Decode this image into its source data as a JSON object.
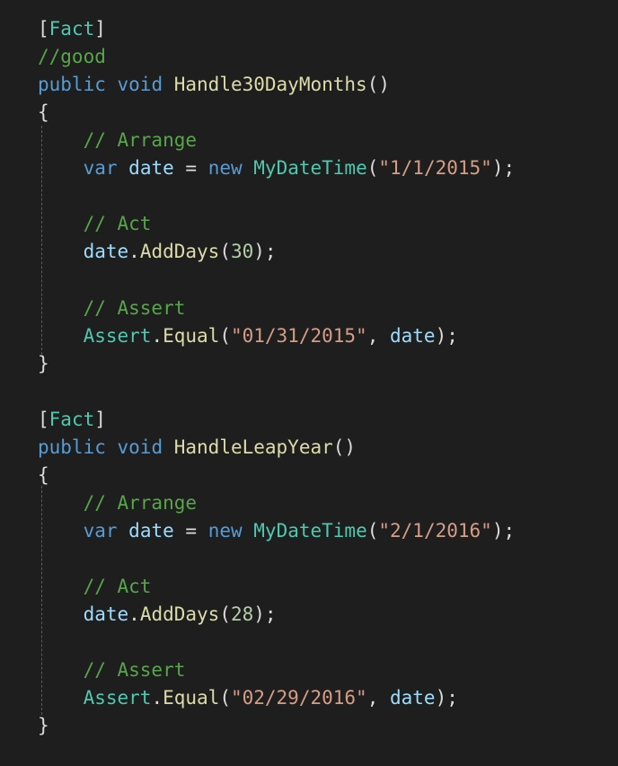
{
  "editor": {
    "language": "C#",
    "theme": "dark",
    "background": "#1e1e1e",
    "colors": {
      "plain": "#dcdcdc",
      "keyword": "#569cd6",
      "type": "#4ec9b0",
      "method": "#dcdcaa",
      "comment": "#57a64a",
      "string": "#d69d85",
      "number": "#b5cea8",
      "variable": "#9cdcfe"
    },
    "lines": [
      [
        [
          "plain",
          "["
        ],
        [
          "type",
          "Fact"
        ],
        [
          "plain",
          "]"
        ]
      ],
      [
        [
          "comment",
          "//good"
        ]
      ],
      [
        [
          "keyword",
          "public"
        ],
        [
          "plain",
          " "
        ],
        [
          "keyword",
          "void"
        ],
        [
          "plain",
          " "
        ],
        [
          "method",
          "Handle30DayMonths"
        ],
        [
          "plain",
          "()"
        ]
      ],
      [
        [
          "plain",
          "{"
        ]
      ],
      [
        [
          "plain",
          "    "
        ],
        [
          "comment",
          "// Arrange"
        ]
      ],
      [
        [
          "plain",
          "    "
        ],
        [
          "keyword",
          "var"
        ],
        [
          "plain",
          " "
        ],
        [
          "var",
          "date"
        ],
        [
          "plain",
          " = "
        ],
        [
          "keyword",
          "new"
        ],
        [
          "plain",
          " "
        ],
        [
          "type",
          "MyDateTime"
        ],
        [
          "plain",
          "("
        ],
        [
          "string",
          "\"1/1/2015\""
        ],
        [
          "plain",
          ");"
        ]
      ],
      [],
      [
        [
          "plain",
          "    "
        ],
        [
          "comment",
          "// Act"
        ]
      ],
      [
        [
          "plain",
          "    "
        ],
        [
          "var",
          "date"
        ],
        [
          "plain",
          "."
        ],
        [
          "method",
          "AddDays"
        ],
        [
          "plain",
          "("
        ],
        [
          "number",
          "30"
        ],
        [
          "plain",
          ");"
        ]
      ],
      [],
      [
        [
          "plain",
          "    "
        ],
        [
          "comment",
          "// Assert"
        ]
      ],
      [
        [
          "plain",
          "    "
        ],
        [
          "type",
          "Assert"
        ],
        [
          "plain",
          "."
        ],
        [
          "method",
          "Equal"
        ],
        [
          "plain",
          "("
        ],
        [
          "string",
          "\"01/31/2015\""
        ],
        [
          "plain",
          ", "
        ],
        [
          "var",
          "date"
        ],
        [
          "plain",
          ");"
        ]
      ],
      [
        [
          "plain",
          "}"
        ]
      ],
      [],
      [
        [
          "plain",
          "["
        ],
        [
          "type",
          "Fact"
        ],
        [
          "plain",
          "]"
        ]
      ],
      [
        [
          "keyword",
          "public"
        ],
        [
          "plain",
          " "
        ],
        [
          "keyword",
          "void"
        ],
        [
          "plain",
          " "
        ],
        [
          "method",
          "HandleLeapYear"
        ],
        [
          "plain",
          "()"
        ]
      ],
      [
        [
          "plain",
          "{"
        ]
      ],
      [
        [
          "plain",
          "    "
        ],
        [
          "comment",
          "// Arrange"
        ]
      ],
      [
        [
          "plain",
          "    "
        ],
        [
          "keyword",
          "var"
        ],
        [
          "plain",
          " "
        ],
        [
          "var",
          "date"
        ],
        [
          "plain",
          " = "
        ],
        [
          "keyword",
          "new"
        ],
        [
          "plain",
          " "
        ],
        [
          "type",
          "MyDateTime"
        ],
        [
          "plain",
          "("
        ],
        [
          "string",
          "\"2/1/2016\""
        ],
        [
          "plain",
          ");"
        ]
      ],
      [],
      [
        [
          "plain",
          "    "
        ],
        [
          "comment",
          "// Act"
        ]
      ],
      [
        [
          "plain",
          "    "
        ],
        [
          "var",
          "date"
        ],
        [
          "plain",
          "."
        ],
        [
          "method",
          "AddDays"
        ],
        [
          "plain",
          "("
        ],
        [
          "number",
          "28"
        ],
        [
          "plain",
          ");"
        ]
      ],
      [],
      [
        [
          "plain",
          "    "
        ],
        [
          "comment",
          "// Assert"
        ]
      ],
      [
        [
          "plain",
          "    "
        ],
        [
          "type",
          "Assert"
        ],
        [
          "plain",
          "."
        ],
        [
          "method",
          "Equal"
        ],
        [
          "plain",
          "("
        ],
        [
          "string",
          "\"02/29/2016\""
        ],
        [
          "plain",
          ", "
        ],
        [
          "var",
          "date"
        ],
        [
          "plain",
          ");"
        ]
      ],
      [
        [
          "plain",
          "}"
        ]
      ]
    ]
  }
}
